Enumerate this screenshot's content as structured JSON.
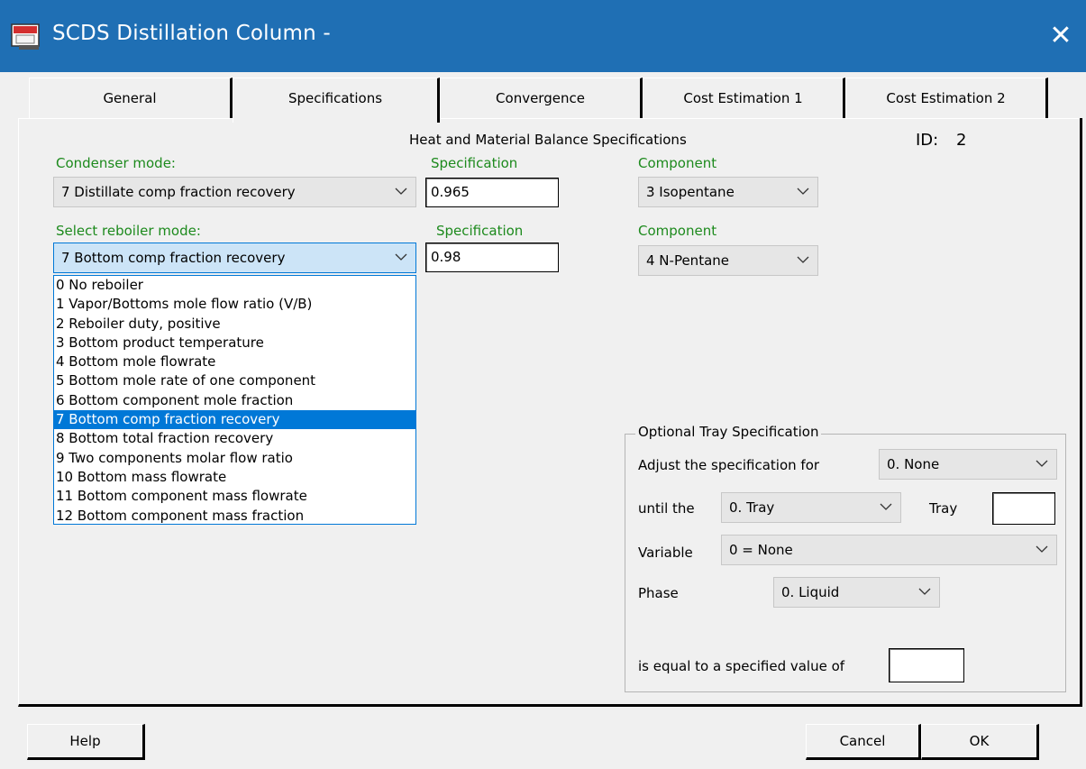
{
  "window": {
    "title": "SCDS Distillation Column -",
    "close_glyph": "✕",
    "icon": "app-logo-icon"
  },
  "tabs": [
    {
      "label": "General",
      "active": false
    },
    {
      "label": "Specifications",
      "active": true
    },
    {
      "label": "Convergence",
      "active": false
    },
    {
      "label": "Cost Estimation 1",
      "active": false
    },
    {
      "label": "Cost Estimation 2",
      "active": false
    }
  ],
  "header": {
    "title": "Heat and Material Balance Specifications",
    "id_label": "ID:",
    "id_value": "2"
  },
  "condenser": {
    "mode_label": "Condenser mode:",
    "mode_value": "7 Distillate comp fraction recovery",
    "spec_label": "Specification",
    "spec_value": "0.965",
    "component_label": "Component",
    "component_value": "3 Isopentane"
  },
  "reboiler": {
    "mode_label": "Select reboiler mode:",
    "mode_value": "7 Bottom comp fraction recovery",
    "spec_label": "Specification",
    "spec_value": "0.98",
    "component_label": "Component",
    "component_value": "4 N-Pentane",
    "options": [
      "0 No reboiler",
      "1 Vapor/Bottoms mole flow ratio (V/B)",
      "2 Reboiler duty, positive",
      "3 Bottom product temperature",
      "4 Bottom mole flowrate",
      "5 Bottom mole rate of one component",
      "6 Bottom component mole fraction",
      "7 Bottom comp fraction recovery",
      "8 Bottom total fraction recovery",
      "9 Two components molar flow ratio",
      "10 Bottom mass flowrate",
      "11 Bottom component mass flowrate",
      "12 Bottom component mass fraction"
    ],
    "selected_index": 7
  },
  "tray_spec": {
    "legend": "Optional Tray Specification",
    "adjust_label": "Adjust the specification for",
    "adjust_value": "0. None",
    "until_label": "until the",
    "until_value": "0. Tray",
    "tray_label": "Tray",
    "tray_value": "",
    "variable_label": "Variable",
    "variable_value": "0 = None",
    "phase_label": "Phase",
    "phase_value": "0. Liquid",
    "equal_label": "is equal to a specified value of",
    "equal_value": ""
  },
  "buttons": {
    "help": "Help",
    "cancel": "Cancel",
    "ok": "OK"
  }
}
